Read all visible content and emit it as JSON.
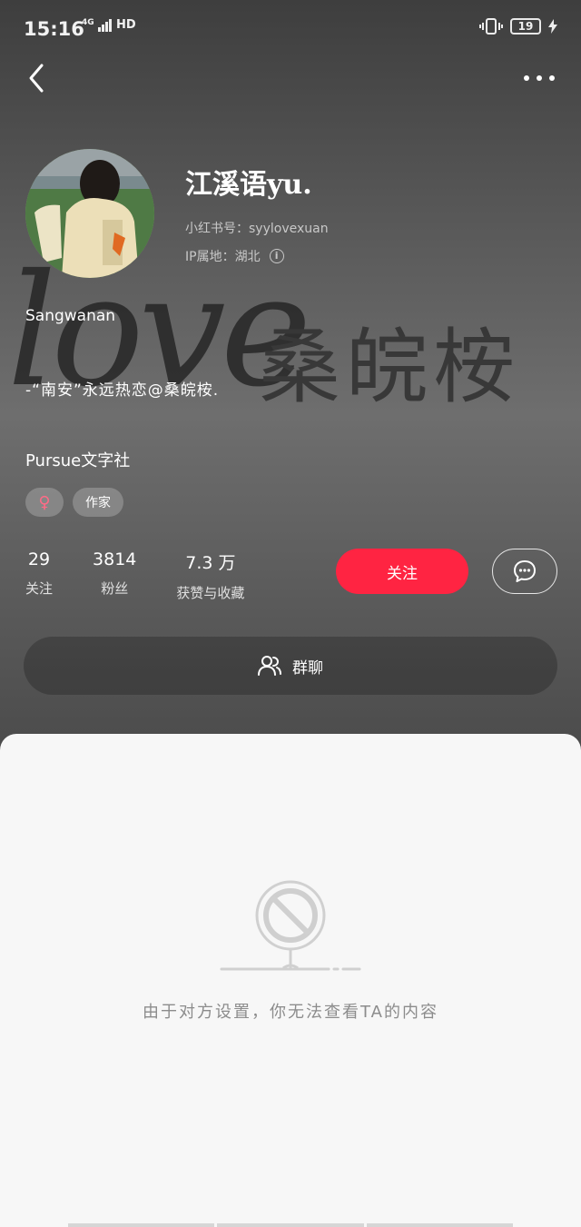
{
  "status_bar": {
    "time": "15:16",
    "network": "4G",
    "hd": "HD",
    "battery": "19"
  },
  "profile": {
    "nickname": "江溪语yu.",
    "redbook_id": "小红书号：syylovexuan",
    "ip_location": "IP属地：湖北",
    "bio_name": "Sangwanan",
    "bio_line": "-“南安”永远热恋@桑皖桉.",
    "org": "Pursue文字社",
    "watermark_love": "love",
    "watermark_name": "桑皖桉"
  },
  "tags": {
    "gender_symbol": "♀",
    "occupation": "作家"
  },
  "stats": [
    {
      "value": "29",
      "label": "关注"
    },
    {
      "value": "3814",
      "label": "粉丝"
    },
    {
      "value": "7.3 万",
      "label": "获赞与收藏"
    }
  ],
  "actions": {
    "follow_label": "关注",
    "group_chat_label": "群聊"
  },
  "empty_state": {
    "message": "由于对方设置，你无法查看TA的内容"
  },
  "colors": {
    "accent": "#ff2442",
    "panel_bg": "#f7f7f7",
    "muted_text": "#8c8c8c"
  }
}
